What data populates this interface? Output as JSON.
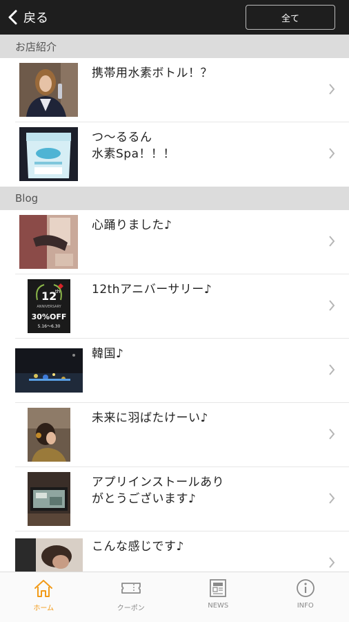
{
  "header": {
    "back_label": "戻る",
    "all_button_label": "全て"
  },
  "sections": [
    {
      "title": "お店紹介",
      "items": [
        {
          "title": "携帯用水素ボトル！？"
        },
        {
          "title": "つ～るるん\n水素Spa！！！"
        }
      ]
    },
    {
      "title": "Blog",
      "items": [
        {
          "title": "心踊りました♪"
        },
        {
          "title": "12thアニバーサリー♪",
          "thumb_text": {
            "num": "12",
            "th": "th",
            "sub": "ANNIVERSARY",
            "off": "30%OFF",
            "dates": "5.16〜6.30"
          }
        },
        {
          "title": "韓国♪"
        },
        {
          "title": "未来に羽ばたけーい♪"
        },
        {
          "title": "アプリインストールあり\nがとうございます♪"
        },
        {
          "title": "こんな感じです♪"
        }
      ]
    }
  ],
  "tabbar": {
    "active_color": "#f29a17",
    "inactive_color": "#8a8a8a",
    "tabs": [
      {
        "label": "ホーム",
        "icon": "home-icon",
        "active": true
      },
      {
        "label": "クーポン",
        "icon": "ticket-icon",
        "active": false
      },
      {
        "label": "NEWS",
        "icon": "newspaper-icon",
        "active": false
      },
      {
        "label": "INFO",
        "icon": "info-icon",
        "active": false
      }
    ]
  }
}
